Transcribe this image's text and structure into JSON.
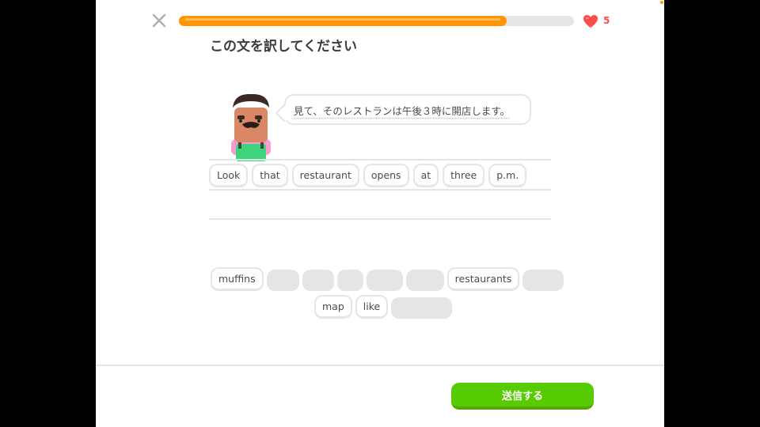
{
  "progress": {
    "fraction": 0.83
  },
  "hearts": {
    "count": "5"
  },
  "title": "この文を訳してください",
  "prompt": {
    "sentence": "見て、そのレストランは午後３時に開店します。"
  },
  "answer": {
    "words": [
      "Look",
      "that",
      "restaurant",
      "opens",
      "at",
      "three",
      "p.m."
    ]
  },
  "word_bank": {
    "row1": [
      {
        "text": "muffins"
      },
      {
        "slot": true
      },
      {
        "slot": true
      },
      {
        "slot": true
      },
      {
        "slot": true
      },
      {
        "slot": true
      },
      {
        "text": "restaurants"
      },
      {
        "slot": true
      }
    ],
    "row2": [
      {
        "text": "map"
      },
      {
        "text": "like"
      },
      {
        "slot": true
      }
    ]
  },
  "submit_label": "送信する",
  "colors": {
    "progress": "#ff9600",
    "heart": "#ff4b4b",
    "submit": "#58cc02"
  },
  "icons": {
    "close": "close-icon",
    "heart": "heart-icon"
  }
}
